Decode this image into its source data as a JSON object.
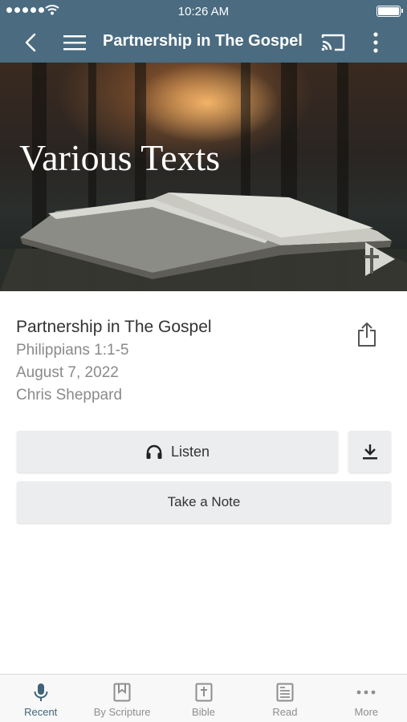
{
  "status_bar": {
    "time": "10:26 AM"
  },
  "nav": {
    "title": "Partnership in The Gospel"
  },
  "hero": {
    "title": "Various Texts"
  },
  "sermon": {
    "title": "Partnership in The Gospel",
    "scripture": "Philippians 1:1-5",
    "date": "August 7, 2022",
    "speaker": "Chris Sheppard"
  },
  "actions": {
    "listen_label": "Listen",
    "note_label": "Take a Note"
  },
  "tabs": [
    {
      "label": "Recent",
      "icon": "microphone-icon",
      "active": true
    },
    {
      "label": "By Scripture",
      "icon": "bookmark-book-icon",
      "active": false
    },
    {
      "label": "Bible",
      "icon": "bible-cross-icon",
      "active": false
    },
    {
      "label": "Read",
      "icon": "document-icon",
      "active": false
    },
    {
      "label": "More",
      "icon": "ellipsis-icon",
      "active": false
    }
  ],
  "colors": {
    "accent": "#4a6b80",
    "active_tab": "#3f6478",
    "button_bg": "#ebedef"
  }
}
